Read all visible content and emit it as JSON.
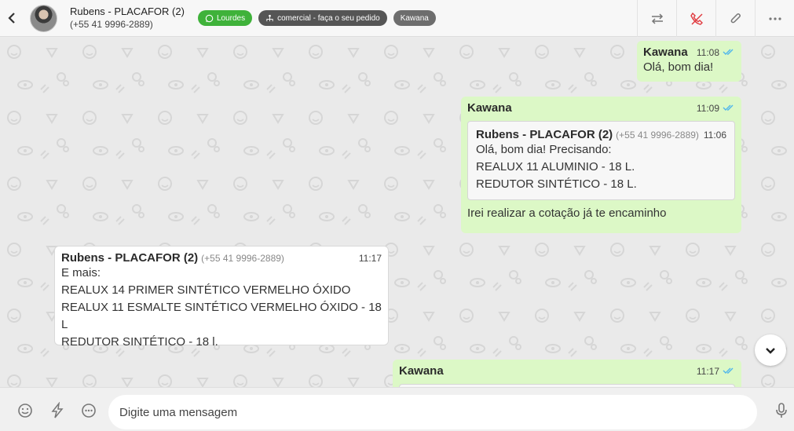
{
  "header": {
    "contact_name": "Rubens - PLACAFOR (2)",
    "contact_phone": "(+55 41 9996-2889)",
    "tags": [
      {
        "label": "Lourdes",
        "color": "#3fb23a",
        "icon": "whatsapp-icon"
      },
      {
        "label": "comercial - faça o seu pedido",
        "color": "#555555",
        "icon": "sitemap-icon"
      },
      {
        "label": "Kawana",
        "color": "#6d6d6d",
        "icon": ""
      }
    ],
    "actions": [
      "transfer-icon",
      "end-call-icon",
      "attach-icon",
      "more-icon"
    ]
  },
  "messages": [
    {
      "type": "out",
      "sender": "Kawana",
      "time": "11:08",
      "text": "Olá, bom dia!",
      "status": "read"
    },
    {
      "type": "out",
      "sender": "Kawana",
      "time": "11:09",
      "status": "read",
      "quoted": {
        "sender": "Rubens - PLACAFOR (2)",
        "phone": "(+55 41 9996-2889)",
        "time": "11:06",
        "lines": [
          "Olá, bom dia! Precisando:",
          "REALUX 11 ALUMINIO - 18 L.",
          "REDUTOR SINTÉTICO - 18 L."
        ]
      },
      "text": "Irei realizar a cotação já te encaminho"
    },
    {
      "type": "in",
      "sender": "Rubens - PLACAFOR (2)",
      "phone": "(+55 41 9996-2889)",
      "time": "11:17",
      "lines": [
        "E mais:",
        "REALUX 14 PRIMER SINTÉTICO VERMELHO ÓXIDO",
        "REALUX 11 ESMALTE SINTÉTICO VERMELHO ÓXIDO - 18 L",
        "REDUTOR SINTÉTICO - 18 l."
      ]
    },
    {
      "type": "out",
      "sender": "Kawana",
      "time": "11:17",
      "status": "read"
    }
  ],
  "composer": {
    "placeholder": "Digite uma mensagem",
    "icons": [
      "emoji-icon",
      "quick-reply-icon",
      "more-options-icon",
      "microphone-icon"
    ]
  },
  "colors": {
    "outgoing_bubble": "#dcf8c6",
    "incoming_bubble": "#ffffff",
    "read_tick": "#4fb6ec",
    "tag_green": "#3fb23a"
  }
}
